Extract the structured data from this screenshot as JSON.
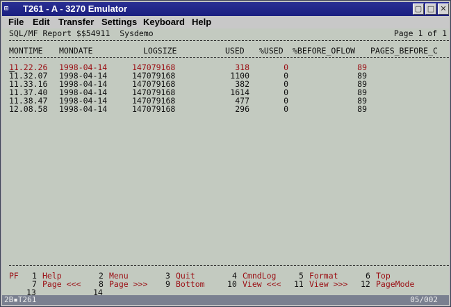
{
  "window": {
    "title": "T261 - A - 3270 Emulator",
    "sys_icon": "⊞",
    "buttons": {
      "restore": "▢",
      "minimize": "□",
      "close": "✕"
    }
  },
  "menubar": {
    "items": [
      {
        "label": "File"
      },
      {
        "label": "Edit"
      },
      {
        "label": "Transfer"
      },
      {
        "label": "Settings"
      },
      {
        "label": "Keyboard"
      },
      {
        "label": "Help"
      }
    ]
  },
  "report": {
    "title": "SQL/MF Report $$54911  Sysdemo",
    "page": "Page 1 of 1",
    "columns": [
      "MONTIME",
      "MONDATE",
      "LOGSIZE",
      "USED",
      "%USED",
      "%BEFORE_OFLOW",
      "PAGES_BEFORE_C"
    ],
    "rows": [
      {
        "montime": "11.22.26",
        "mondate": "1998-04-14",
        "logsize": "147079168",
        "used": "318",
        "pct_used": "0",
        "before_oflow": "89",
        "highlight": true
      },
      {
        "montime": "11.32.07",
        "mondate": "1998-04-14",
        "logsize": "147079168",
        "used": "1100",
        "pct_used": "0",
        "before_oflow": "89",
        "highlight": false
      },
      {
        "montime": "11.33.16",
        "mondate": "1998-04-14",
        "logsize": "147079168",
        "used": "382",
        "pct_used": "0",
        "before_oflow": "89",
        "highlight": false
      },
      {
        "montime": "11.37.40",
        "mondate": "1998-04-14",
        "logsize": "147079168",
        "used": "1614",
        "pct_used": "0",
        "before_oflow": "89",
        "highlight": false
      },
      {
        "montime": "11.38.47",
        "mondate": "1998-04-14",
        "logsize": "147079168",
        "used": "477",
        "pct_used": "0",
        "before_oflow": "89",
        "highlight": false
      },
      {
        "montime": "12.08.58",
        "mondate": "1998-04-14",
        "logsize": "147079168",
        "used": "296",
        "pct_used": "0",
        "before_oflow": "89",
        "highlight": false
      }
    ]
  },
  "pfkeys": {
    "prefix": "PF",
    "line1": [
      {
        "num": "1",
        "label": "Help"
      },
      {
        "num": "2",
        "label": "Menu"
      },
      {
        "num": "3",
        "label": "Quit"
      },
      {
        "num": "4",
        "label": "CmndLog"
      },
      {
        "num": "5",
        "label": "Format"
      },
      {
        "num": "6",
        "label": "Top"
      }
    ],
    "line2": [
      {
        "num": "7",
        "label": "Page <<<"
      },
      {
        "num": "8",
        "label": "Page >>>"
      },
      {
        "num": "9",
        "label": "Bottom"
      },
      {
        "num": "10",
        "label": "View <<<"
      },
      {
        "num": "11",
        "label": "View >>>"
      },
      {
        "num": "12",
        "label": "PageMode"
      }
    ],
    "line3": [
      {
        "num": "13",
        "label": ""
      },
      {
        "num": "14",
        "label": ""
      }
    ]
  },
  "statusbar": {
    "left": "2B▪T261",
    "right": "05/002"
  },
  "colors": {
    "highlight_row": "#9a0d12",
    "pf_labels": "#9a0d12",
    "pf_numbers": "#101010",
    "titlebar": "#1a1e80"
  }
}
